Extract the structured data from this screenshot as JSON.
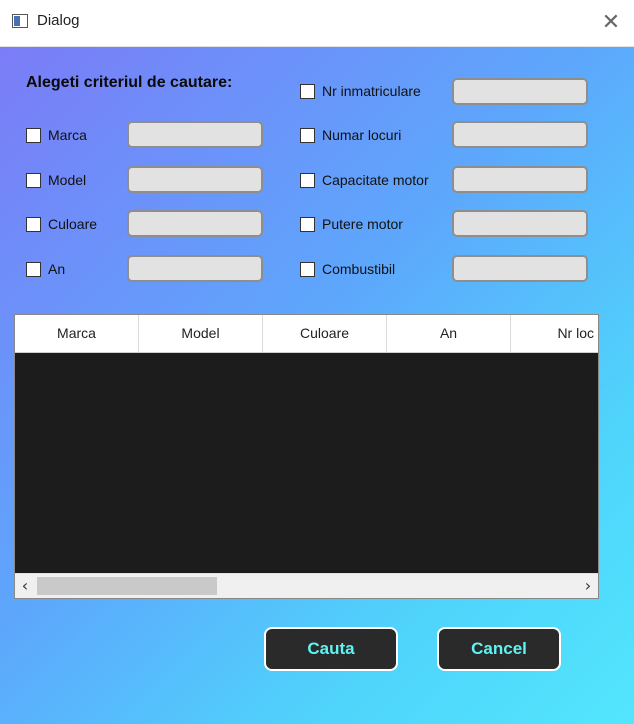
{
  "window": {
    "title": "Dialog",
    "close_glyph": "✕"
  },
  "search": {
    "heading": "Alegeti criteriul de cautare:",
    "left_criteria": [
      {
        "label": "Marca",
        "checked": false,
        "value": ""
      },
      {
        "label": "Model",
        "checked": false,
        "value": ""
      },
      {
        "label": "Culoare",
        "checked": false,
        "value": ""
      },
      {
        "label": "An",
        "checked": false,
        "value": ""
      }
    ],
    "right_criteria": [
      {
        "label": "Nr inmatriculare",
        "checked": false,
        "value": ""
      },
      {
        "label": "Numar locuri",
        "checked": false,
        "value": ""
      },
      {
        "label": "Capacitate motor",
        "checked": false,
        "value": ""
      },
      {
        "label": "Putere motor",
        "checked": false,
        "value": ""
      },
      {
        "label": "Combustibil",
        "checked": false,
        "value": ""
      }
    ]
  },
  "results_table": {
    "columns": [
      "Marca",
      "Model",
      "Culoare",
      "An",
      "Nr loc"
    ],
    "rows": [],
    "scroll_left_glyph": "‹",
    "scroll_right_glyph": "›"
  },
  "actions": {
    "search_label": "Cauta",
    "cancel_label": "Cancel"
  },
  "colors": {
    "gradient_start": "#7b7cf7",
    "gradient_end": "#52e6fd",
    "button_bg": "#2a2a2a",
    "button_text": "#5ff3f3",
    "table_body": "#1c1c1c"
  }
}
